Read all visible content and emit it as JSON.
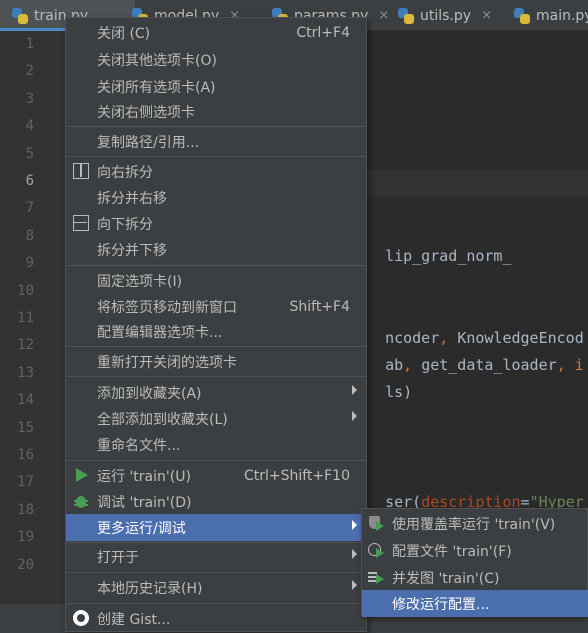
{
  "tabs": [
    {
      "name": "train.py",
      "active": true
    },
    {
      "name": "model.py",
      "active": false
    },
    {
      "name": "params.py",
      "active": false
    },
    {
      "name": "utils.py",
      "active": false
    },
    {
      "name": "main.py",
      "active": false
    }
  ],
  "close_glyph": "×",
  "gutter": {
    "line_numbers": [
      "1",
      "2",
      "3",
      "4",
      "5",
      "6",
      "7",
      "8",
      "9",
      "10",
      "11",
      "12",
      "13",
      "14",
      "15",
      "16",
      "17",
      "18",
      "19",
      "20"
    ],
    "current_line": "6"
  },
  "code_fragments": {
    "line8": "lip_grad_norm_",
    "line11_a": "ncoder",
    "line11_b": ", ",
    "line11_c": "KnowledgeEncod",
    "line12_a": "ab",
    "line12_b": ", ",
    "line12_c": "get_data_loader",
    "line12_d": ", i",
    "line13": "ls)",
    "line17_a": "ser(",
    "line17_b": "description",
    "line17_c": "=",
    "line17_d": "\"Hyper"
  },
  "menu": {
    "close": {
      "label": "关闭 (C)",
      "shortcut": "Ctrl+F4"
    },
    "close_others": {
      "label": "关闭其他选项卡(O)"
    },
    "close_all": {
      "label": "关闭所有选项卡(A)"
    },
    "close_right": {
      "label": "关闭右侧选项卡"
    },
    "copy_path": {
      "label": "复制路径/引用..."
    },
    "split_right": {
      "label": "向右拆分"
    },
    "split_move_right": {
      "label": "拆分并右移"
    },
    "split_down": {
      "label": "向下拆分"
    },
    "split_move_down": {
      "label": "拆分并下移"
    },
    "pin_tab": {
      "label": "固定选项卡(I)"
    },
    "move_new_window": {
      "label": "将标签页移动到新窗口",
      "shortcut": "Shift+F4"
    },
    "config_tabs": {
      "label": "配置编辑器选项卡..."
    },
    "reopen_closed": {
      "label": "重新打开关闭的选项卡"
    },
    "add_favorites": {
      "label": "添加到收藏夹(A)"
    },
    "add_all_favorites": {
      "label": "全部添加到收藏夹(L)"
    },
    "rename_file": {
      "label": "重命名文件..."
    },
    "run": {
      "label": "运行 'train'(U)",
      "shortcut": "Ctrl+Shift+F10"
    },
    "debug": {
      "label": "调试 'train'(D)"
    },
    "more_run": {
      "label": "更多运行/调试"
    },
    "open_in": {
      "label": "打开于"
    },
    "local_history": {
      "label": "本地历史记录(H)"
    },
    "create_gist": {
      "label": "创建 Gist..."
    }
  },
  "submenu": {
    "run_coverage": {
      "label": "使用覆盖率运行 'train'(V)"
    },
    "profile": {
      "label": "配置文件 'train'(F)"
    },
    "concurrency": {
      "label": "并发图 'train'(C)"
    },
    "modify_config": {
      "label": "修改运行配置..."
    }
  },
  "colors": {
    "selection": "#4b6eaf",
    "run_green": "#499c54",
    "menu_bg": "#3c3f41",
    "editor_bg": "#2b2b2b",
    "accent_tab": "#4a88c7"
  },
  "icons": {
    "tab_file": "python-file-icon",
    "split_right": "split-vertical-icon",
    "split_down": "split-horizontal-icon",
    "run": "run-icon",
    "debug": "debug-bug-icon",
    "gist": "github-icon",
    "coverage": "coverage-icon",
    "profile": "profiler-icon",
    "concurrency": "concurrency-icon",
    "submenu": "chevron-right-icon"
  }
}
